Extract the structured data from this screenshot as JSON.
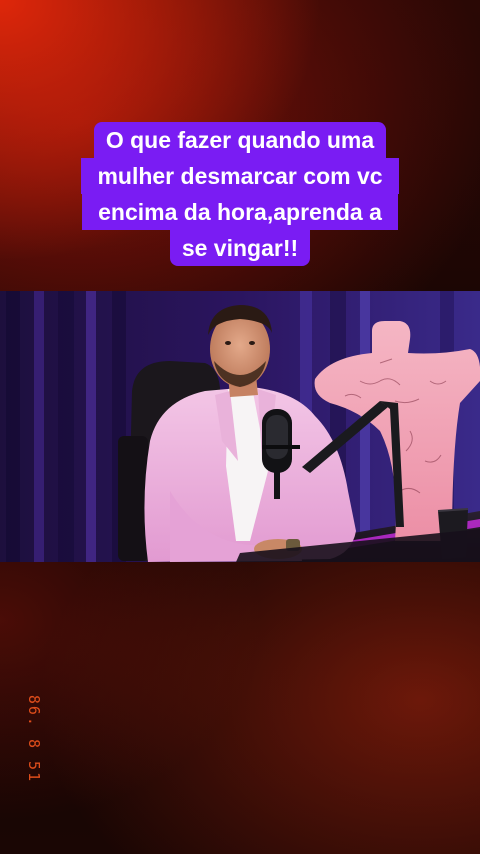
{
  "caption": {
    "lines": [
      "O que fazer quando uma",
      "mulher desmarcar com vc",
      "encima da hora,aprenda a",
      "se vingar!!"
    ],
    "background_color": "#7a1cf3",
    "text_color": "#ffffff"
  },
  "video": {
    "scene": "podcast-studio"
  },
  "timestamp": {
    "text": "86. 8 51",
    "color": "#ff5a1f"
  }
}
